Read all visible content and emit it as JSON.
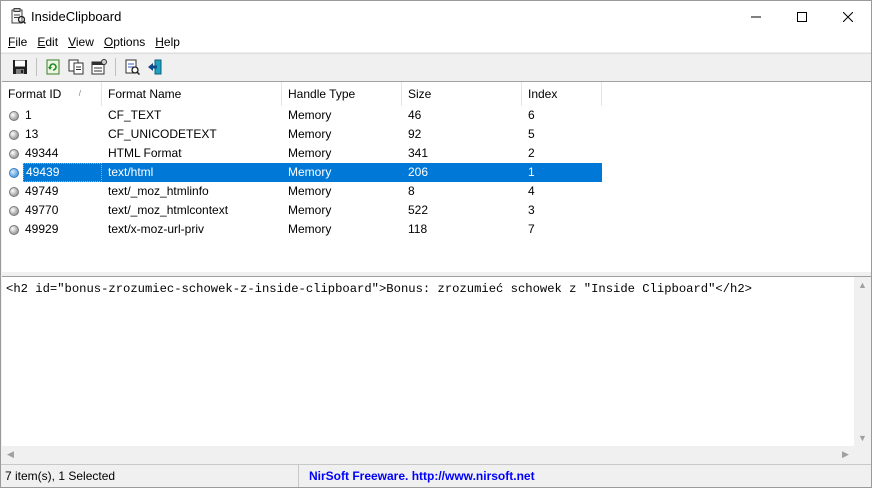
{
  "window": {
    "title": "InsideClipboard"
  },
  "menu": {
    "items": [
      "File",
      "Edit",
      "View",
      "Options",
      "Help"
    ]
  },
  "toolbar": {
    "buttons": [
      "save-icon",
      "refresh-icon",
      "copy-icon",
      "properties-icon",
      "html-report-icon",
      "exit-icon"
    ]
  },
  "list": {
    "columns": [
      "Format ID",
      "Format Name",
      "Handle Type",
      "Size",
      "Index"
    ],
    "sorted_column": "Format ID",
    "rows": [
      {
        "id": "1",
        "name": "CF_TEXT",
        "handle": "Memory",
        "size": "46",
        "index": "6",
        "selected": false
      },
      {
        "id": "13",
        "name": "CF_UNICODETEXT",
        "handle": "Memory",
        "size": "92",
        "index": "5",
        "selected": false
      },
      {
        "id": "49344",
        "name": "HTML Format",
        "handle": "Memory",
        "size": "341",
        "index": "2",
        "selected": false
      },
      {
        "id": "49439",
        "name": "text/html",
        "handle": "Memory",
        "size": "206",
        "index": "1",
        "selected": true
      },
      {
        "id": "49749",
        "name": "text/_moz_htmlinfo",
        "handle": "Memory",
        "size": "8",
        "index": "4",
        "selected": false
      },
      {
        "id": "49770",
        "name": "text/_moz_htmlcontext",
        "handle": "Memory",
        "size": "522",
        "index": "3",
        "selected": false
      },
      {
        "id": "49929",
        "name": "text/x-moz-url-priv",
        "handle": "Memory",
        "size": "118",
        "index": "7",
        "selected": false
      }
    ]
  },
  "content": {
    "text": "<h2 id=\"bonus-zrozumiec-schowek-z-inside-clipboard\">Bonus: zrozumieć schowek z \"Inside Clipboard\"</h2>"
  },
  "status": {
    "count": "7 item(s), 1 Selected",
    "link": "NirSoft Freeware.  http://www.nirsoft.net"
  },
  "colors": {
    "selection": "#0078d7",
    "link": "#0000ff"
  }
}
